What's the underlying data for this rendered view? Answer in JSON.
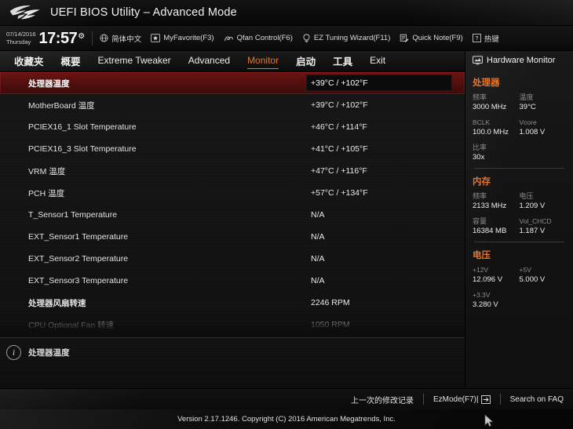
{
  "titlebar": {
    "logo_name": "rog-logo",
    "title": "UEFI BIOS Utility – Advanced Mode"
  },
  "toolbar": {
    "date": "07/14/2016",
    "weekday": "Thursday",
    "time": "17:57",
    "gear_icon": "gear-icon",
    "items": [
      {
        "icon": "globe-icon",
        "label": "简体中文"
      },
      {
        "icon": "star-icon",
        "label": "MyFavorite(F3)"
      },
      {
        "icon": "fan-icon",
        "label": "Qfan Control(F6)"
      },
      {
        "icon": "bulb-icon",
        "label": "EZ Tuning Wizard(F11)"
      },
      {
        "icon": "note-icon",
        "label": "Quick Note(F9)"
      },
      {
        "icon": "question-icon",
        "label": "热键"
      }
    ]
  },
  "nav": {
    "active_color": "#e8762a",
    "tabs": [
      {
        "label": "收藏夹",
        "cjk": true,
        "active": false
      },
      {
        "label": "概要",
        "cjk": true,
        "active": false
      },
      {
        "label": "Extreme Tweaker",
        "cjk": false,
        "active": false
      },
      {
        "label": "Advanced",
        "cjk": false,
        "active": false
      },
      {
        "label": "Monitor",
        "cjk": false,
        "active": true
      },
      {
        "label": "启动",
        "cjk": true,
        "active": false
      },
      {
        "label": "工具",
        "cjk": true,
        "active": false
      },
      {
        "label": "Exit",
        "cjk": false,
        "active": false
      }
    ]
  },
  "main": {
    "rows": [
      {
        "label": "处理器温度",
        "value": "+39°C / +102°F",
        "cjk": true,
        "selected": true,
        "clipped": false
      },
      {
        "label": "MotherBoard 温度",
        "value": "+39°C / +102°F",
        "cjk": false,
        "selected": false,
        "clipped": false
      },
      {
        "label": "PCIEX16_1 Slot Temperature",
        "value": "+46°C / +114°F",
        "cjk": false,
        "selected": false,
        "clipped": false
      },
      {
        "label": "PCIEX16_3 Slot Temperature",
        "value": "+41°C / +105°F",
        "cjk": false,
        "selected": false,
        "clipped": false
      },
      {
        "label": "VRM 温度",
        "value": "+47°C / +116°F",
        "cjk": false,
        "selected": false,
        "clipped": false
      },
      {
        "label": "PCH 温度",
        "value": "+57°C / +134°F",
        "cjk": false,
        "selected": false,
        "clipped": false
      },
      {
        "label": "T_Sensor1 Temperature",
        "value": "N/A",
        "cjk": false,
        "selected": false,
        "clipped": false
      },
      {
        "label": "EXT_Sensor1  Temperature",
        "value": "N/A",
        "cjk": false,
        "selected": false,
        "clipped": false
      },
      {
        "label": "EXT_Sensor2  Temperature",
        "value": "N/A",
        "cjk": false,
        "selected": false,
        "clipped": false
      },
      {
        "label": "EXT_Sensor3  Temperature",
        "value": "N/A",
        "cjk": false,
        "selected": false,
        "clipped": false
      },
      {
        "label": "处理器风扇转速",
        "value": "2246 RPM",
        "cjk": true,
        "selected": false,
        "clipped": false
      },
      {
        "label": "CPU Optional Fan 转速",
        "value": "1050 RPM",
        "cjk": false,
        "selected": false,
        "clipped": true
      }
    ]
  },
  "sidebar": {
    "title": "Hardware Monitor",
    "title_icon": "monitor-icon",
    "sections": [
      {
        "title": "处理器",
        "pairs": [
          [
            {
              "key": "频率",
              "value": "3000 MHz",
              "cjk": true
            },
            {
              "key": "温度",
              "value": "39°C",
              "cjk": true
            }
          ],
          [
            {
              "key": "BCLK",
              "value": "100.0 MHz",
              "cjk": false
            },
            {
              "key": "Vcore",
              "value": "1.008 V",
              "cjk": false
            }
          ],
          [
            {
              "key": "比率",
              "value": "30x",
              "cjk": true
            },
            null
          ]
        ]
      },
      {
        "title": "内存",
        "pairs": [
          [
            {
              "key": "频率",
              "value": "2133 MHz",
              "cjk": true
            },
            {
              "key": "电压",
              "value": "1.209 V",
              "cjk": true
            }
          ],
          [
            {
              "key": "容量",
              "value": "16384 MB",
              "cjk": true
            },
            {
              "key": "Vol_CHCD",
              "value": "1.187 V",
              "cjk": false
            }
          ]
        ]
      },
      {
        "title": "电压",
        "pairs": [
          [
            {
              "key": "+12V",
              "value": "12.096 V",
              "cjk": false
            },
            {
              "key": "+5V",
              "value": "5.000 V",
              "cjk": false
            }
          ],
          [
            {
              "key": "+3.3V",
              "value": "3.280 V",
              "cjk": false
            },
            null
          ]
        ]
      }
    ]
  },
  "helpbar": {
    "info_icon": "info-icon",
    "text": "处理器温度"
  },
  "footer": {
    "last_modified": "上一次的修改记录",
    "ez_mode": "EzMode(F7)|",
    "ez_mode_icon": "exit-arrow-icon",
    "search_faq": "Search on FAQ"
  },
  "copyright": {
    "text": "Version 2.17.1246. Copyright (C) 2016 American Megatrends, Inc."
  }
}
